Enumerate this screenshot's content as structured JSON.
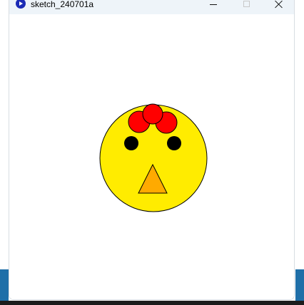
{
  "window": {
    "title": "sketch_240701a",
    "controls": {
      "minimize": "minimize",
      "maximize": "maximize",
      "close": "close"
    }
  },
  "colors": {
    "face": "#ffec00",
    "bow": "#ff0000",
    "eyes": "#000000",
    "beak": "#ffaa00",
    "outline": "#000000",
    "canvas_background": "#ffffff",
    "app_icon": "#1b2bb5",
    "titlebar": "#eef4f9"
  },
  "icons": {
    "app": "processing-app-icon",
    "minimize": "minimize-icon",
    "maximize": "maximize-icon",
    "close": "close-icon"
  }
}
